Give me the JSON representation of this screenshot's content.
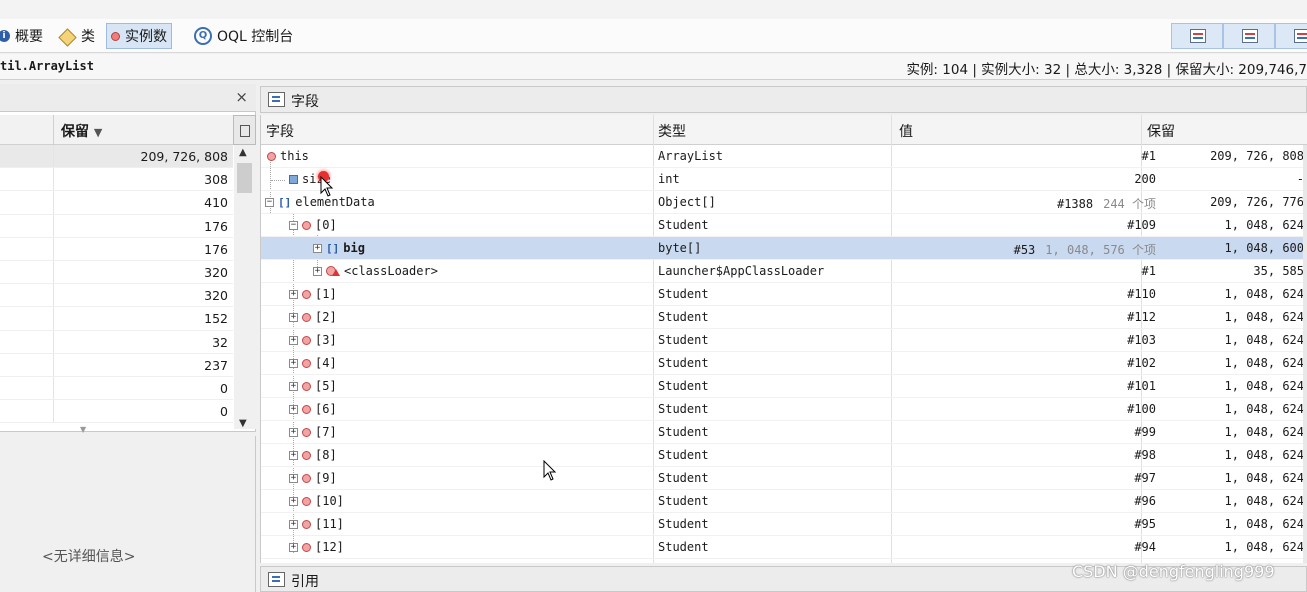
{
  "toolbar": {
    "tabs": [
      {
        "label": "概要",
        "icon": "info-icon"
      },
      {
        "label": "类",
        "icon": "class-icon"
      },
      {
        "label": "实例数",
        "icon": "instance-icon",
        "active": true
      },
      {
        "label": "OQL 控制台",
        "icon": "oql-icon"
      }
    ],
    "buttons": [
      "view-icon",
      "tree-view-icon",
      "layout-icon"
    ]
  },
  "status": {
    "class_name": "til.ArrayList",
    "stats": "实例: 104  |  实例大小: 32  |  总大小: 3,328  |  保留大小: 209,746,7"
  },
  "left": {
    "close": "×",
    "column_label": "保留",
    "sort_indicator": "▼",
    "values": [
      "209, 726, 808",
      "308",
      "410",
      "176",
      "176",
      "320",
      "320",
      "152",
      "32",
      "237",
      "0",
      "0"
    ],
    "no_detail": "<无详细信息>"
  },
  "fields_panel": {
    "title": "字段",
    "columns": {
      "field": "字段",
      "type": "类型",
      "value": "值",
      "retained": "保留"
    },
    "rows": [
      {
        "name": "this",
        "type": "ArrayList",
        "value": "#1",
        "extra": "",
        "retained": "209, 726, 808"
      },
      {
        "name": "size",
        "type": "int",
        "value": "200",
        "extra": "",
        "retained": "-"
      },
      {
        "name": "elementData",
        "type": "Object[]",
        "value": "#1388",
        "extra": "244 个项",
        "retained": "209, 726, 776"
      },
      {
        "name": "[0]",
        "type": "Student",
        "value": "#109",
        "extra": "",
        "retained": "1, 048, 624"
      },
      {
        "name": "big",
        "type": "byte[]",
        "value": "#53",
        "extra": "1, 048, 576 个项",
        "retained": "1, 048, 600"
      },
      {
        "name": "<classLoader>",
        "type": "Launcher$AppClassLoader",
        "value": "#1",
        "extra": "",
        "retained": "35, 585"
      },
      {
        "name": "[1]",
        "type": "Student",
        "value": "#110",
        "extra": "",
        "retained": "1, 048, 624"
      },
      {
        "name": "[2]",
        "type": "Student",
        "value": "#112",
        "extra": "",
        "retained": "1, 048, 624"
      },
      {
        "name": "[3]",
        "type": "Student",
        "value": "#103",
        "extra": "",
        "retained": "1, 048, 624"
      },
      {
        "name": "[4]",
        "type": "Student",
        "value": "#102",
        "extra": "",
        "retained": "1, 048, 624"
      },
      {
        "name": "[5]",
        "type": "Student",
        "value": "#101",
        "extra": "",
        "retained": "1, 048, 624"
      },
      {
        "name": "[6]",
        "type": "Student",
        "value": "#100",
        "extra": "",
        "retained": "1, 048, 624"
      },
      {
        "name": "[7]",
        "type": "Student",
        "value": "#99",
        "extra": "",
        "retained": "1, 048, 624"
      },
      {
        "name": "[8]",
        "type": "Student",
        "value": "#98",
        "extra": "",
        "retained": "1, 048, 624"
      },
      {
        "name": "[9]",
        "type": "Student",
        "value": "#97",
        "extra": "",
        "retained": "1, 048, 624"
      },
      {
        "name": "[10]",
        "type": "Student",
        "value": "#96",
        "extra": "",
        "retained": "1, 048, 624"
      },
      {
        "name": "[11]",
        "type": "Student",
        "value": "#95",
        "extra": "",
        "retained": "1, 048, 624"
      },
      {
        "name": "[12]",
        "type": "Student",
        "value": "#94",
        "extra": "",
        "retained": "1, 048, 624"
      }
    ]
  },
  "refs_panel": {
    "title": "引用"
  },
  "watermark": "CSDN @dengfengling999"
}
